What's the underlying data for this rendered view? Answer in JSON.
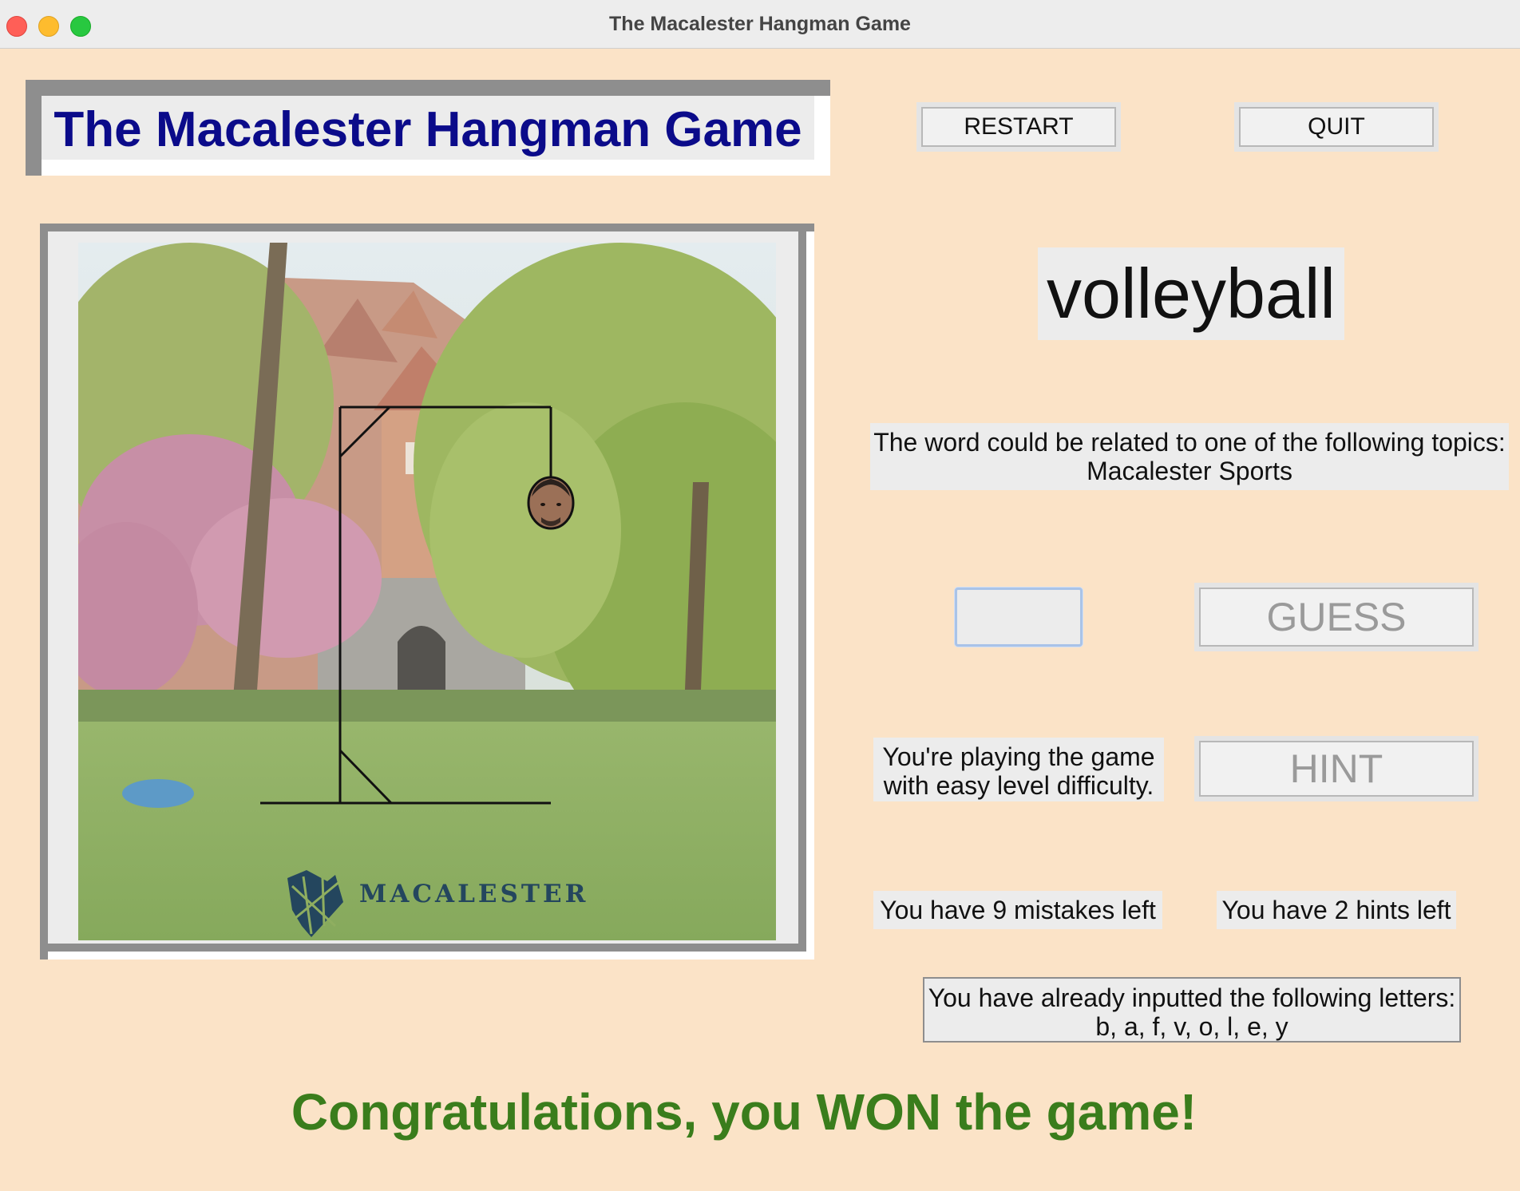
{
  "window": {
    "title": "The Macalester Hangman Game"
  },
  "header": {
    "title": "The Macalester Hangman Game"
  },
  "buttons": {
    "restart": "RESTART",
    "quit": "QUIT",
    "guess": "GUESS",
    "hint": "HINT"
  },
  "game": {
    "word": "volleyball",
    "topic_line1": "The word could be related to one of the following topics:",
    "topic_line2": "Macalester Sports",
    "guess_input_value": "",
    "level_line1": "You're playing the game",
    "level_line2": "with easy level difficulty.",
    "mistakes_left": "You have 9 mistakes left",
    "hints_left": "You have 2 hints left",
    "letters_line1": "You have already inputted the following letters:",
    "letters_line2": "b, a, f, v, o, l, e, y",
    "result_message": "Congratulations, you WON the game!"
  },
  "image": {
    "logo_text": "MACALESTER"
  },
  "colors": {
    "background": "#fbe3c7",
    "header_text": "#0b0b8a",
    "win_text": "#3a7d1c"
  },
  "icons": {
    "close": "close-icon",
    "minimize": "minimize-icon",
    "zoom": "zoom-icon"
  }
}
